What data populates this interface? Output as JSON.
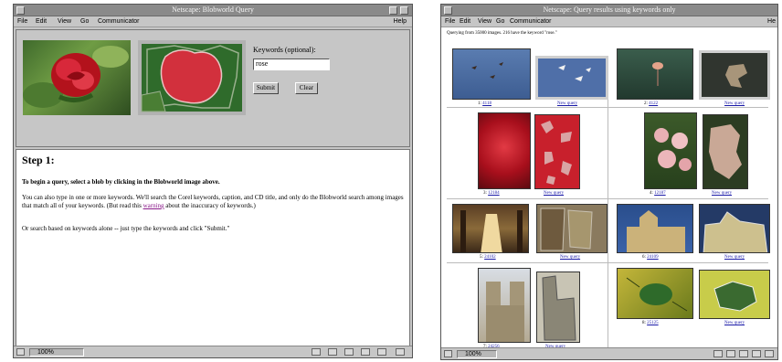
{
  "left_window": {
    "title": "Netscape: Blobworld Query",
    "menu": [
      "File",
      "Edit",
      "View",
      "Go",
      "Communicator"
    ],
    "help": "Help",
    "keywords_label": "Keywords (optional):",
    "keywords_value": "rose",
    "submit_label": "Submit",
    "clear_label": "Clear",
    "heading": "Step 1:",
    "instruction": "To begin a query, select a blob by clicking in the Blobworld image above.",
    "paragraph2_part1": "You can also type in one or more keywords. We'll search the Corel keywords, caption, and CD title, and only do the Blobworld search among images that match all of your keywords. (But read this ",
    "paragraph2_link": "warning",
    "paragraph2_part2": " about the inaccuracy of keywords.)",
    "paragraph3": "Or search based on keywords alone -- just type the keywords and click \"Submit.\"",
    "zoom": "100%"
  },
  "right_window": {
    "title": "Netscape: Query results using keywords only",
    "menu": [
      "File",
      "Edit",
      "View",
      "Go",
      "Communicator"
    ],
    "help": "He",
    "query_text": "Querying from 35000 images. 216 have the keyword \"rose.\"",
    "zoom": "100%",
    "results": [
      {
        "num": "1:",
        "id": "4118",
        "new_query": "New query"
      },
      {
        "num": "2:",
        "id": "4122",
        "new_query": "New query"
      },
      {
        "num": "3:",
        "id": "12184",
        "new_query": "New query"
      },
      {
        "num": "4:",
        "id": "12187",
        "new_query": "New query"
      },
      {
        "num": "5:",
        "id": "24102",
        "new_query": "New query"
      },
      {
        "num": "6:",
        "id": "24109",
        "new_query": "New query"
      },
      {
        "num": "7:",
        "id": "24256",
        "new_query": "New query"
      },
      {
        "num": "8:",
        "id": "25125",
        "new_query": "New query"
      }
    ]
  }
}
